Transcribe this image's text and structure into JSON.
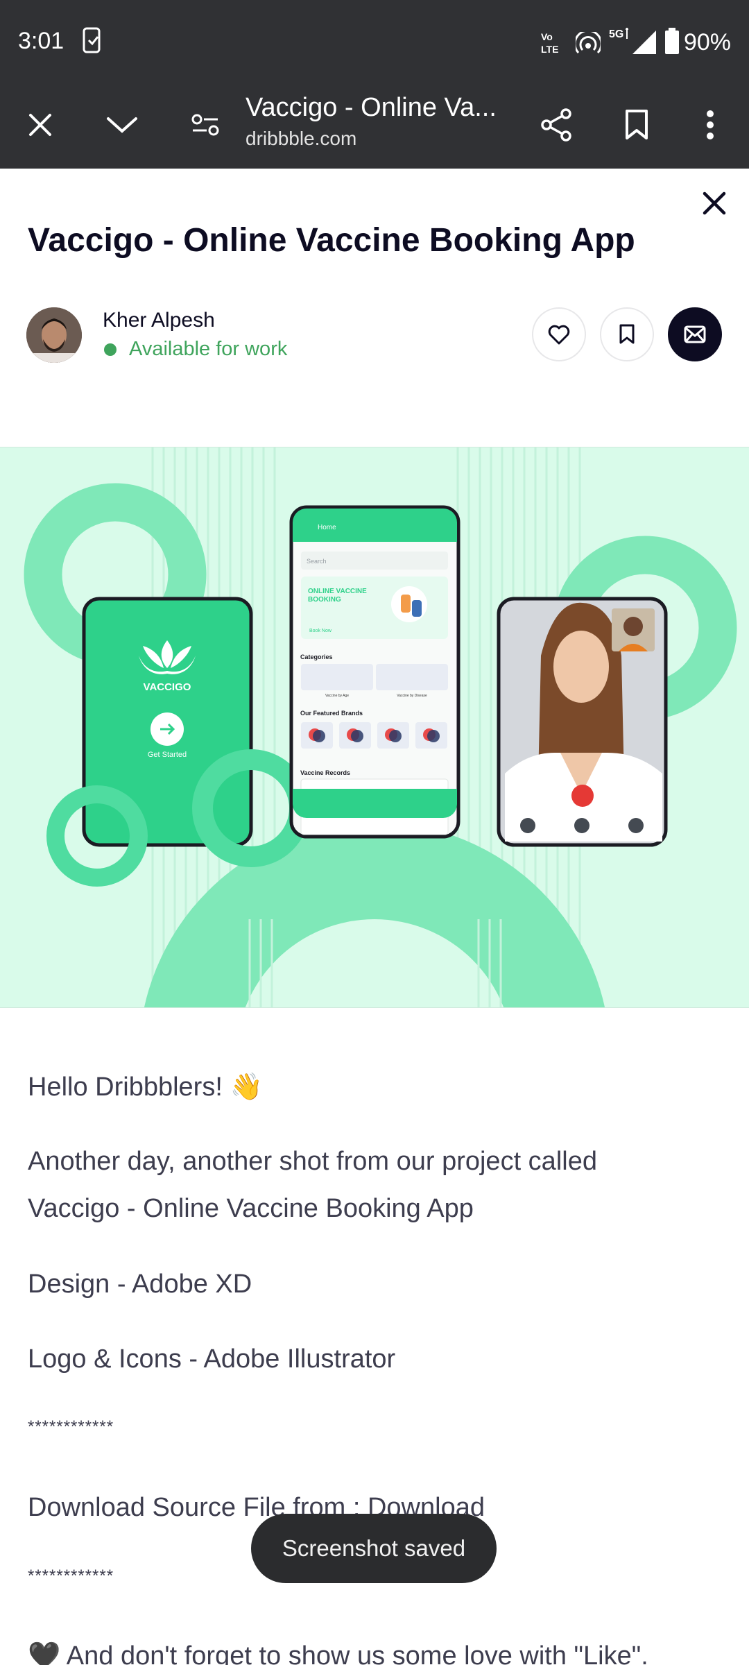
{
  "status_bar": {
    "time": "3:01",
    "network": "5G",
    "volte": "Vo LTE",
    "battery": "90%",
    "icons": [
      "screenshot-icon",
      "volte-icon",
      "hotspot-icon",
      "signal-icon",
      "battery-icon"
    ]
  },
  "browser": {
    "title": "Vaccigo - Online Va...",
    "url": "dribbble.com",
    "icons": [
      "close-icon",
      "chevron-down-icon",
      "site-settings-icon",
      "share-icon",
      "bookmark-icon",
      "more-vert-icon"
    ]
  },
  "shot": {
    "title": "Vaccigo - Online Vaccine Booking App",
    "author": "Kher Alpesh",
    "availability": "Available for work",
    "actions": [
      "heart-icon",
      "bookmark-icon",
      "mail-icon"
    ]
  },
  "hero": {
    "splash_brand": "VACCIGO",
    "splash_cta": "Get Started",
    "home_header": "Home",
    "search_placeholder": "Search",
    "banner_title_1": "ONLINE VACCINE",
    "banner_title_2": "BOOKING",
    "banner_cta": "Book Now",
    "section_categories": "Categories",
    "cat_1": "Vaccine by Age",
    "cat_2": "Vaccine by Disease",
    "section_brands": "Our Featured Brands",
    "section_records": "Vaccine Records"
  },
  "description": {
    "greeting": "Hello Dribbblers! 👋",
    "line1": "Another day, another shot from our project called",
    "line2": "Vaccigo - Online Vaccine Booking App",
    "design": "Design - Adobe XD",
    "logo": "Logo & Icons - Adobe Illustrator",
    "stars1": "************",
    "download": "Download Source File from : Download",
    "stars2": "************",
    "love": "🖤 And don't forget to show us some love with \"Like\"."
  },
  "toast": "Screenshot saved",
  "colors": {
    "accent": "#2ed18a",
    "hero_bg": "#d9fbea",
    "toolbar": "#303134",
    "available": "#3fa45c"
  }
}
